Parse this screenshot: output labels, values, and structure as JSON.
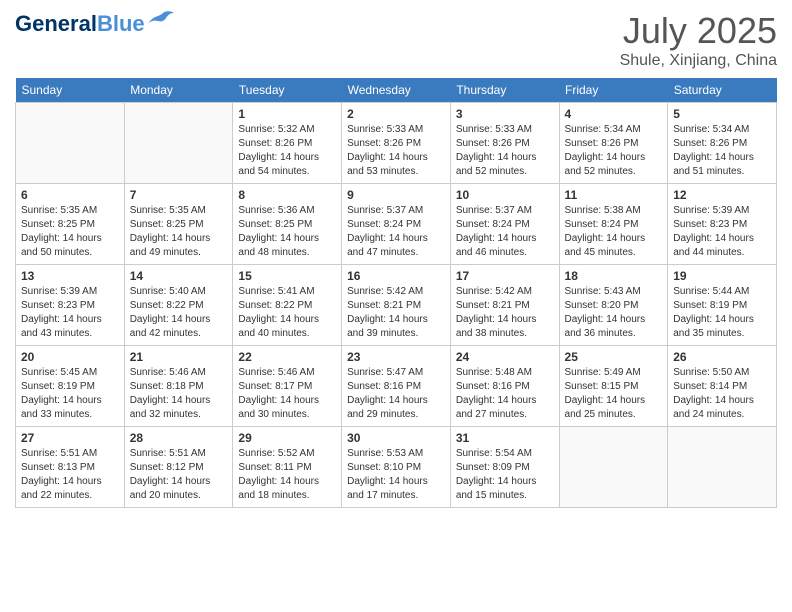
{
  "header": {
    "logo_general": "General",
    "logo_blue": "Blue",
    "month_year": "July 2025",
    "location": "Shule, Xinjiang, China"
  },
  "days_of_week": [
    "Sunday",
    "Monday",
    "Tuesday",
    "Wednesday",
    "Thursday",
    "Friday",
    "Saturday"
  ],
  "weeks": [
    [
      {
        "day": "",
        "sunrise": "",
        "sunset": "",
        "daylight": ""
      },
      {
        "day": "",
        "sunrise": "",
        "sunset": "",
        "daylight": ""
      },
      {
        "day": "1",
        "sunrise": "Sunrise: 5:32 AM",
        "sunset": "Sunset: 8:26 PM",
        "daylight": "Daylight: 14 hours and 54 minutes."
      },
      {
        "day": "2",
        "sunrise": "Sunrise: 5:33 AM",
        "sunset": "Sunset: 8:26 PM",
        "daylight": "Daylight: 14 hours and 53 minutes."
      },
      {
        "day": "3",
        "sunrise": "Sunrise: 5:33 AM",
        "sunset": "Sunset: 8:26 PM",
        "daylight": "Daylight: 14 hours and 52 minutes."
      },
      {
        "day": "4",
        "sunrise": "Sunrise: 5:34 AM",
        "sunset": "Sunset: 8:26 PM",
        "daylight": "Daylight: 14 hours and 52 minutes."
      },
      {
        "day": "5",
        "sunrise": "Sunrise: 5:34 AM",
        "sunset": "Sunset: 8:26 PM",
        "daylight": "Daylight: 14 hours and 51 minutes."
      }
    ],
    [
      {
        "day": "6",
        "sunrise": "Sunrise: 5:35 AM",
        "sunset": "Sunset: 8:25 PM",
        "daylight": "Daylight: 14 hours and 50 minutes."
      },
      {
        "day": "7",
        "sunrise": "Sunrise: 5:35 AM",
        "sunset": "Sunset: 8:25 PM",
        "daylight": "Daylight: 14 hours and 49 minutes."
      },
      {
        "day": "8",
        "sunrise": "Sunrise: 5:36 AM",
        "sunset": "Sunset: 8:25 PM",
        "daylight": "Daylight: 14 hours and 48 minutes."
      },
      {
        "day": "9",
        "sunrise": "Sunrise: 5:37 AM",
        "sunset": "Sunset: 8:24 PM",
        "daylight": "Daylight: 14 hours and 47 minutes."
      },
      {
        "day": "10",
        "sunrise": "Sunrise: 5:37 AM",
        "sunset": "Sunset: 8:24 PM",
        "daylight": "Daylight: 14 hours and 46 minutes."
      },
      {
        "day": "11",
        "sunrise": "Sunrise: 5:38 AM",
        "sunset": "Sunset: 8:24 PM",
        "daylight": "Daylight: 14 hours and 45 minutes."
      },
      {
        "day": "12",
        "sunrise": "Sunrise: 5:39 AM",
        "sunset": "Sunset: 8:23 PM",
        "daylight": "Daylight: 14 hours and 44 minutes."
      }
    ],
    [
      {
        "day": "13",
        "sunrise": "Sunrise: 5:39 AM",
        "sunset": "Sunset: 8:23 PM",
        "daylight": "Daylight: 14 hours and 43 minutes."
      },
      {
        "day": "14",
        "sunrise": "Sunrise: 5:40 AM",
        "sunset": "Sunset: 8:22 PM",
        "daylight": "Daylight: 14 hours and 42 minutes."
      },
      {
        "day": "15",
        "sunrise": "Sunrise: 5:41 AM",
        "sunset": "Sunset: 8:22 PM",
        "daylight": "Daylight: 14 hours and 40 minutes."
      },
      {
        "day": "16",
        "sunrise": "Sunrise: 5:42 AM",
        "sunset": "Sunset: 8:21 PM",
        "daylight": "Daylight: 14 hours and 39 minutes."
      },
      {
        "day": "17",
        "sunrise": "Sunrise: 5:42 AM",
        "sunset": "Sunset: 8:21 PM",
        "daylight": "Daylight: 14 hours and 38 minutes."
      },
      {
        "day": "18",
        "sunrise": "Sunrise: 5:43 AM",
        "sunset": "Sunset: 8:20 PM",
        "daylight": "Daylight: 14 hours and 36 minutes."
      },
      {
        "day": "19",
        "sunrise": "Sunrise: 5:44 AM",
        "sunset": "Sunset: 8:19 PM",
        "daylight": "Daylight: 14 hours and 35 minutes."
      }
    ],
    [
      {
        "day": "20",
        "sunrise": "Sunrise: 5:45 AM",
        "sunset": "Sunset: 8:19 PM",
        "daylight": "Daylight: 14 hours and 33 minutes."
      },
      {
        "day": "21",
        "sunrise": "Sunrise: 5:46 AM",
        "sunset": "Sunset: 8:18 PM",
        "daylight": "Daylight: 14 hours and 32 minutes."
      },
      {
        "day": "22",
        "sunrise": "Sunrise: 5:46 AM",
        "sunset": "Sunset: 8:17 PM",
        "daylight": "Daylight: 14 hours and 30 minutes."
      },
      {
        "day": "23",
        "sunrise": "Sunrise: 5:47 AM",
        "sunset": "Sunset: 8:16 PM",
        "daylight": "Daylight: 14 hours and 29 minutes."
      },
      {
        "day": "24",
        "sunrise": "Sunrise: 5:48 AM",
        "sunset": "Sunset: 8:16 PM",
        "daylight": "Daylight: 14 hours and 27 minutes."
      },
      {
        "day": "25",
        "sunrise": "Sunrise: 5:49 AM",
        "sunset": "Sunset: 8:15 PM",
        "daylight": "Daylight: 14 hours and 25 minutes."
      },
      {
        "day": "26",
        "sunrise": "Sunrise: 5:50 AM",
        "sunset": "Sunset: 8:14 PM",
        "daylight": "Daylight: 14 hours and 24 minutes."
      }
    ],
    [
      {
        "day": "27",
        "sunrise": "Sunrise: 5:51 AM",
        "sunset": "Sunset: 8:13 PM",
        "daylight": "Daylight: 14 hours and 22 minutes."
      },
      {
        "day": "28",
        "sunrise": "Sunrise: 5:51 AM",
        "sunset": "Sunset: 8:12 PM",
        "daylight": "Daylight: 14 hours and 20 minutes."
      },
      {
        "day": "29",
        "sunrise": "Sunrise: 5:52 AM",
        "sunset": "Sunset: 8:11 PM",
        "daylight": "Daylight: 14 hours and 18 minutes."
      },
      {
        "day": "30",
        "sunrise": "Sunrise: 5:53 AM",
        "sunset": "Sunset: 8:10 PM",
        "daylight": "Daylight: 14 hours and 17 minutes."
      },
      {
        "day": "31",
        "sunrise": "Sunrise: 5:54 AM",
        "sunset": "Sunset: 8:09 PM",
        "daylight": "Daylight: 14 hours and 15 minutes."
      },
      {
        "day": "",
        "sunrise": "",
        "sunset": "",
        "daylight": ""
      },
      {
        "day": "",
        "sunrise": "",
        "sunset": "",
        "daylight": ""
      }
    ]
  ]
}
